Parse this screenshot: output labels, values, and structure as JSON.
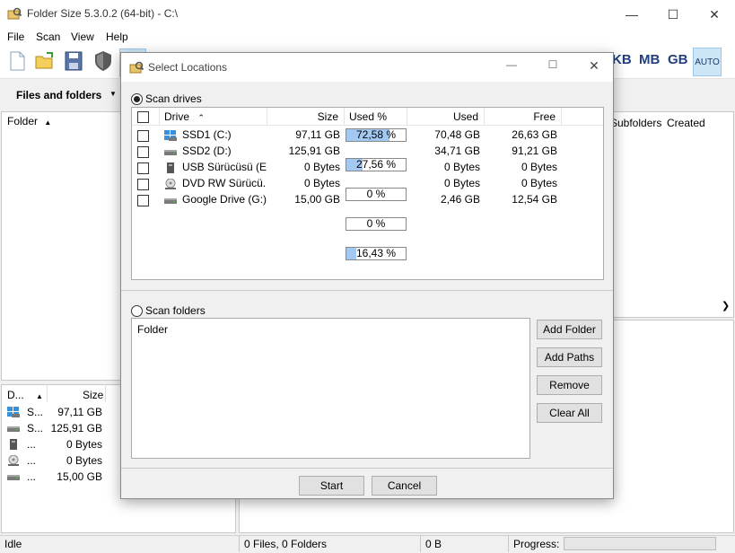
{
  "window": {
    "title": "Folder Size 5.3.0.2 (64-bit) - C:\\"
  },
  "menu": [
    "File",
    "Scan",
    "View",
    "Help"
  ],
  "toolbar": {
    "units": [
      "KB",
      "MB",
      "GB"
    ],
    "auto": "AUTO",
    "files_folders": "Files and folders"
  },
  "tree": {
    "folder_col": "Folder"
  },
  "right_cols": {
    "subfolders": "Subfolders",
    "created": "Created"
  },
  "drive_list": {
    "col_drive": "D...",
    "col_size": "Size",
    "rows": [
      {
        "name": "S...",
        "size": "97,11 GB",
        "icon": "windows-drive-icon"
      },
      {
        "name": "S...",
        "size": "125,91 GB",
        "icon": "hard-drive-icon"
      },
      {
        "name": "...",
        "size": "0 Bytes",
        "icon": "usb-drive-icon"
      },
      {
        "name": "...",
        "size": "0 Bytes",
        "icon": "dvd-drive-icon"
      },
      {
        "name": "...",
        "size": "15,00 GB",
        "icon": "hard-drive-icon"
      }
    ]
  },
  "status": {
    "state": "Idle",
    "counts": "0 Files, 0 Folders",
    "bytes": "0 B",
    "progress_label": "Progress:"
  },
  "dialog": {
    "title": "Select Locations",
    "scan_drives": "Scan drives",
    "scan_folders": "Scan folders",
    "cols": {
      "drive": "Drive",
      "size": "Size",
      "used_pct": "Used %",
      "used": "Used",
      "free": "Free"
    },
    "drives": [
      {
        "name": "SSD1 (C:)",
        "size": "97,11 GB",
        "used_pct_text": "72,58 %",
        "used_frac": 0.7258,
        "used": "70,48 GB",
        "free": "26,63 GB",
        "icon": "windows-drive-icon"
      },
      {
        "name": "SSD2 (D:)",
        "size": "125,91 GB",
        "used_pct_text": "27,56 %",
        "used_frac": 0.2756,
        "used": "34,71 GB",
        "free": "91,21 GB",
        "icon": "hard-drive-icon"
      },
      {
        "name": "USB Sürücüsü (E:)",
        "size": "0 Bytes",
        "used_pct_text": "0 %",
        "used_frac": 0,
        "used": "0 Bytes",
        "free": "0 Bytes",
        "icon": "usb-drive-icon"
      },
      {
        "name": "DVD RW Sürücü...",
        "size": "0 Bytes",
        "used_pct_text": "0 %",
        "used_frac": 0,
        "used": "0 Bytes",
        "free": "0 Bytes",
        "icon": "dvd-drive-icon"
      },
      {
        "name": "Google Drive (G:)",
        "size": "15,00 GB",
        "used_pct_text": "16,43 %",
        "used_frac": 0.1643,
        "used": "2,46 GB",
        "free": "12,54 GB",
        "icon": "hard-drive-icon"
      }
    ],
    "folder_col": "Folder",
    "buttons": {
      "add_folder": "Add Folder",
      "add_paths": "Add Paths",
      "remove": "Remove",
      "clear_all": "Clear All",
      "start": "Start",
      "cancel": "Cancel"
    }
  },
  "colors": {
    "accent": "#a3c8f1",
    "unit_text": "#233e7d"
  }
}
